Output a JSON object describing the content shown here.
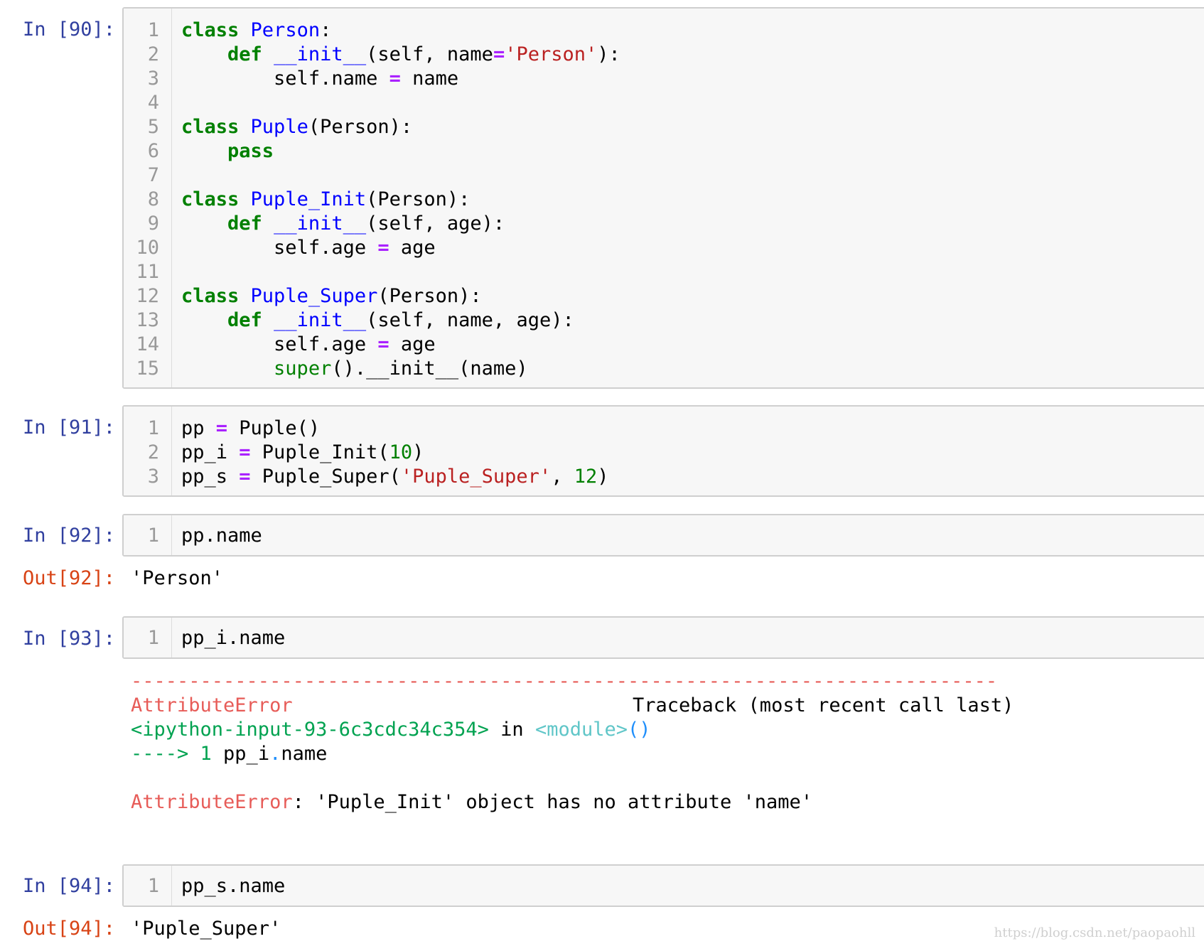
{
  "cells": {
    "c90": {
      "prompt": "In [90]:",
      "line_numbers": [
        "1",
        "2",
        "3",
        "4",
        "5",
        "6",
        "7",
        "8",
        "9",
        "10",
        "11",
        "12",
        "13",
        "14",
        "15"
      ],
      "code": {
        "l1_kw": "class",
        "l1_name": "Person",
        "l1_rest": ":",
        "l2_kw": "def",
        "l2_name": "__init__",
        "l2_a": "(self, name",
        "l2_op": "=",
        "l2_str": "'Person'",
        "l2_b": "):",
        "l3_a": "self.name ",
        "l3_op": "=",
        "l3_b": " name",
        "l5_kw": "class",
        "l5_name": "Puple",
        "l5_rest": "(Person):",
        "l6_kw": "pass",
        "l8_kw": "class",
        "l8_name": "Puple_Init",
        "l8_rest": "(Person):",
        "l9_kw": "def",
        "l9_name": "__init__",
        "l9_rest": "(self, age):",
        "l10_a": "self.age ",
        "l10_op": "=",
        "l10_b": " age",
        "l12_kw": "class",
        "l12_name": "Puple_Super",
        "l12_rest": "(Person):",
        "l13_kw": "def",
        "l13_name": "__init__",
        "l13_rest": "(self, name, age):",
        "l14_a": "self.age ",
        "l14_op": "=",
        "l14_b": " age",
        "l15_bi": "super",
        "l15_rest": "().__init__(name)"
      }
    },
    "c91": {
      "prompt": "In [91]:",
      "line_numbers": [
        "1",
        "2",
        "3"
      ],
      "code": {
        "l1_a": "pp ",
        "l1_op": "=",
        "l1_b": " Puple()",
        "l2_a": "pp_i ",
        "l2_op": "=",
        "l2_b": " Puple_Init(",
        "l2_num": "10",
        "l2_c": ")",
        "l3_a": "pp_s ",
        "l3_op": "=",
        "l3_b": " Puple_Super(",
        "l3_str": "'Puple_Super'",
        "l3_c": ", ",
        "l3_num": "12",
        "l3_d": ")"
      }
    },
    "c92": {
      "prompt": "In [92]:",
      "line_numbers": [
        "1"
      ],
      "code": "pp.name",
      "out_prompt": "Out[92]:",
      "output": "'Person'"
    },
    "c93": {
      "prompt": "In [93]:",
      "line_numbers": [
        "1"
      ],
      "code": "pp_i.name",
      "traceback": {
        "dashes": "---------------------------------------------------------------------------",
        "error_name": "AttributeError",
        "traceback_label": "Traceback (most recent call last)",
        "input_ref": "<ipython-input-93-6c3cdc34c354>",
        "in_word": " in ",
        "module_ref": "<module>",
        "module_parens": "()",
        "arrow": "----> 1 ",
        "arrow_code_a": "pp_i",
        "arrow_code_dot": ".",
        "arrow_code_b": "name",
        "final_error_name": "AttributeError",
        "final_message": ": 'Puple_Init' object has no attribute 'name'"
      }
    },
    "c94": {
      "prompt": "In [94]:",
      "line_numbers": [
        "1"
      ],
      "code": "pp_s.name",
      "out_prompt": "Out[94]:",
      "output": "'Puple_Super'"
    }
  },
  "watermark": "https://blog.csdn.net/paopaohll"
}
